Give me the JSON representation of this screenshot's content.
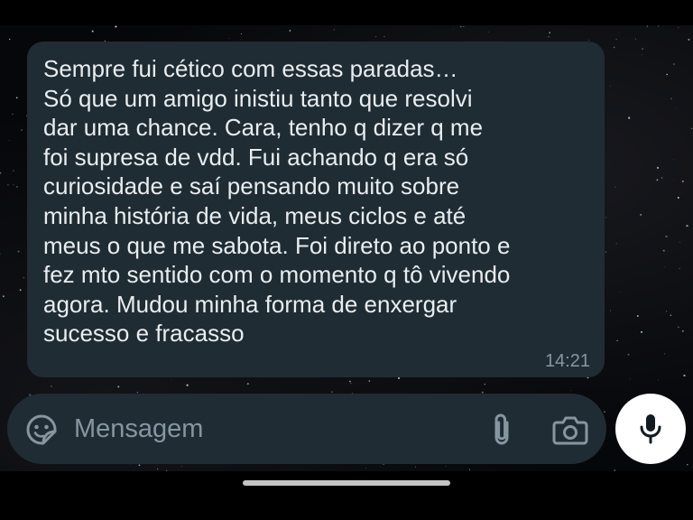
{
  "chat": {
    "message": {
      "lines": [
        "Sempre fui cético com essas paradas…",
        "Só que um amigo inistiu tanto que resolvi",
        "dar uma chance. Cara, tenho q dizer q me",
        "foi supresa de vdd. Fui achando q era só",
        "curiosidade e saí pensando muito sobre",
        "minha história de vida, meus ciclos e até",
        "meus o que me sabota. Foi direto ao ponto e",
        "fez mto sentido com o momento q tô vivendo",
        "agora. Mudou minha forma de enxergar",
        "sucesso e fracasso"
      ],
      "time": "14:21"
    }
  },
  "composer": {
    "placeholder": "Mensagem",
    "icons": {
      "sticker": "sticker-icon",
      "attach": "paperclip-icon",
      "camera": "camera-icon",
      "mic": "microphone-icon"
    }
  },
  "colors": {
    "bubble": "#1f2c34",
    "text": "#e9edef",
    "muted": "#8696a0",
    "mic_button": "#ffffff"
  }
}
